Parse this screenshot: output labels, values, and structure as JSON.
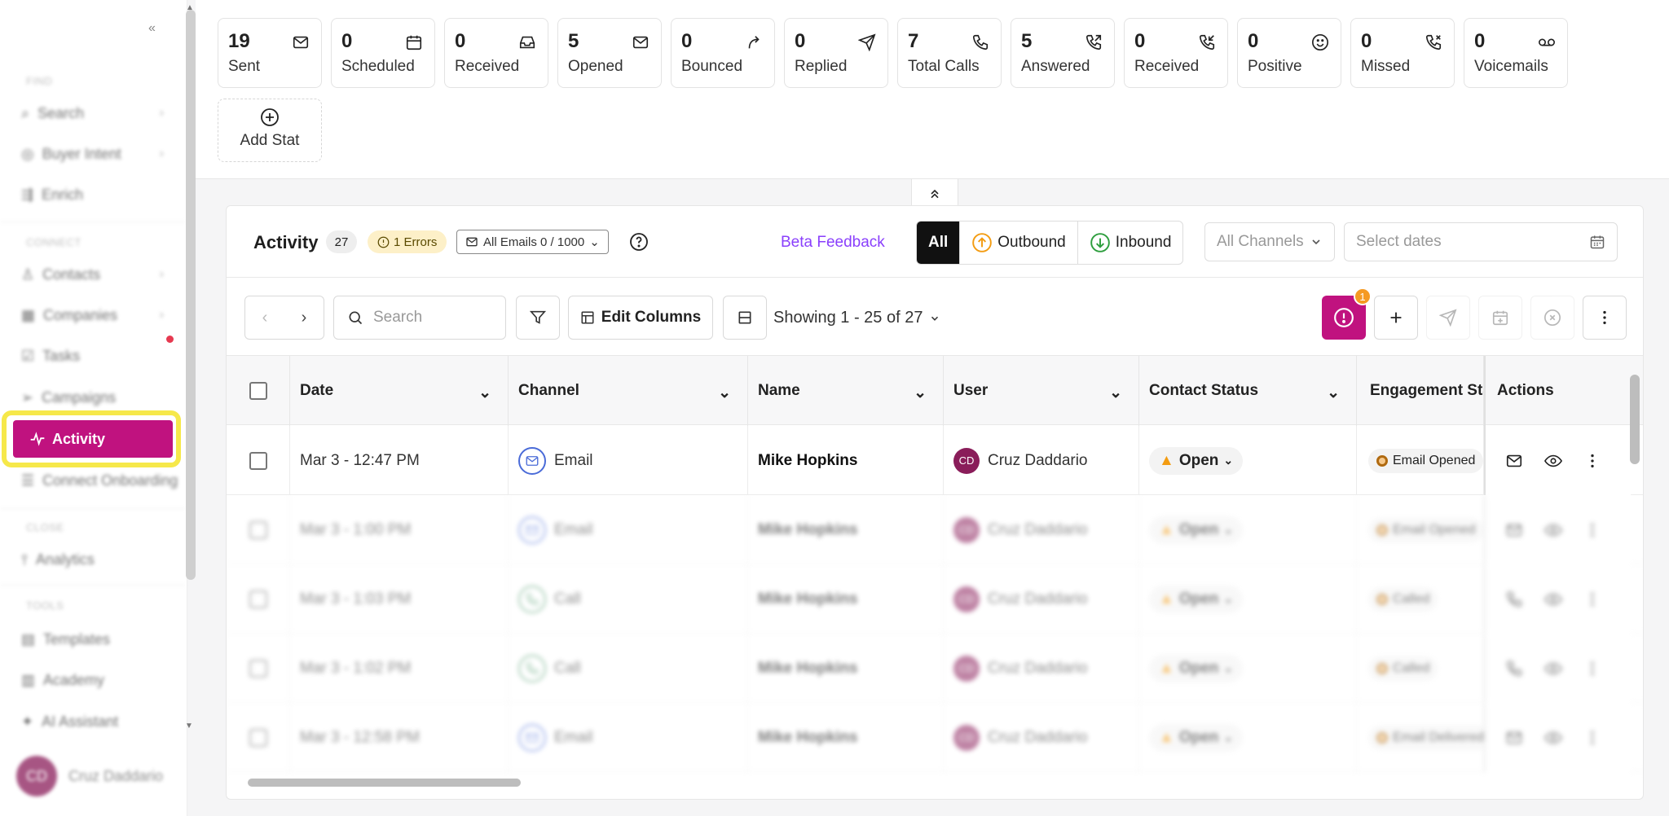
{
  "sidebar": {
    "collapse_glyph": "«",
    "sections": {
      "find": "FIND",
      "connect": "CONNECT",
      "close": "CLOSE",
      "tools": "TOOLS"
    },
    "items": {
      "search": "Search",
      "buyer_intent": "Buyer Intent",
      "enrich": "Enrich",
      "contacts": "Contacts",
      "companies": "Companies",
      "tasks": "Tasks",
      "campaigns": "Campaigns",
      "activity": "Activity",
      "connect_onboarding": "Connect Onboarding",
      "analytics": "Analytics",
      "templates": "Templates",
      "academy": "Academy",
      "ai_assistant": "AI Assistant"
    },
    "user": {
      "initials": "CD",
      "name": "Cruz Daddario"
    }
  },
  "stats": [
    {
      "value": "19",
      "label": "Sent",
      "icon": "mail-icon"
    },
    {
      "value": "0",
      "label": "Scheduled",
      "icon": "calendar-icon"
    },
    {
      "value": "0",
      "label": "Received",
      "icon": "inbox-icon"
    },
    {
      "value": "5",
      "label": "Opened",
      "icon": "mail-icon"
    },
    {
      "value": "0",
      "label": "Bounced",
      "icon": "bounce-icon"
    },
    {
      "value": "0",
      "label": "Replied",
      "icon": "send-icon"
    },
    {
      "value": "7",
      "label": "Total Calls",
      "icon": "phone-icon"
    },
    {
      "value": "5",
      "label": "Answered",
      "icon": "phone-outgoing-icon"
    },
    {
      "value": "0",
      "label": "Received",
      "icon": "phone-incoming-icon"
    },
    {
      "value": "0",
      "label": "Positive",
      "icon": "smile-icon"
    },
    {
      "value": "0",
      "label": "Missed",
      "icon": "phone-missed-icon"
    },
    {
      "value": "0",
      "label": "Voicemails",
      "icon": "voicemail-icon"
    }
  ],
  "add_stat": "Add Stat",
  "activity": {
    "title": "Activity",
    "count": "27",
    "errors": "1 Errors",
    "emails_quota": "All Emails 0 / 1000",
    "beta_feedback": "Beta Feedback",
    "filters": {
      "all": "All",
      "outbound": "Outbound",
      "inbound": "Inbound"
    },
    "channels_placeholder": "All Channels",
    "dates_placeholder": "Select dates"
  },
  "toolbar": {
    "search_placeholder": "Search",
    "edit_columns": "Edit Columns",
    "showing": "Showing 1 - 25 of 27",
    "alert_badge": "1"
  },
  "table": {
    "columns": {
      "date": "Date",
      "channel": "Channel",
      "name": "Name",
      "user": "User",
      "contact_status": "Contact Status",
      "engagement_status": "Engagement Sta",
      "actions": "Actions"
    },
    "rows": [
      {
        "date": "Mar 3 - 12:47 PM",
        "channel": "Email",
        "name": "Mike Hopkins",
        "user_initials": "CD",
        "user": "Cruz Daddario",
        "status": "Open",
        "engagement": "Email Opened"
      },
      {
        "date": "Mar 3 - 1:00 PM",
        "channel": "Email",
        "name": "Mike Hopkins",
        "user_initials": "CD",
        "user": "Cruz Daddario",
        "status": "Open",
        "engagement": "Email Opened"
      },
      {
        "date": "Mar 3 - 1:03 PM",
        "channel": "Call",
        "name": "Mike Hopkins",
        "user_initials": "CD",
        "user": "Cruz Daddario",
        "status": "Open",
        "engagement": "Called"
      },
      {
        "date": "Mar 3 - 1:02 PM",
        "channel": "Call",
        "name": "Mike Hopkins",
        "user_initials": "CD",
        "user": "Cruz Daddario",
        "status": "Open",
        "engagement": "Called"
      },
      {
        "date": "Mar 3 - 12:58 PM",
        "channel": "Email",
        "name": "Mike Hopkins",
        "user_initials": "CD",
        "user": "Cruz Daddario",
        "status": "Open",
        "engagement": "Email Delivered"
      }
    ]
  },
  "colors": {
    "brand": "#c0127f",
    "highlight": "#f6e84a",
    "badge": "#f59a23"
  }
}
